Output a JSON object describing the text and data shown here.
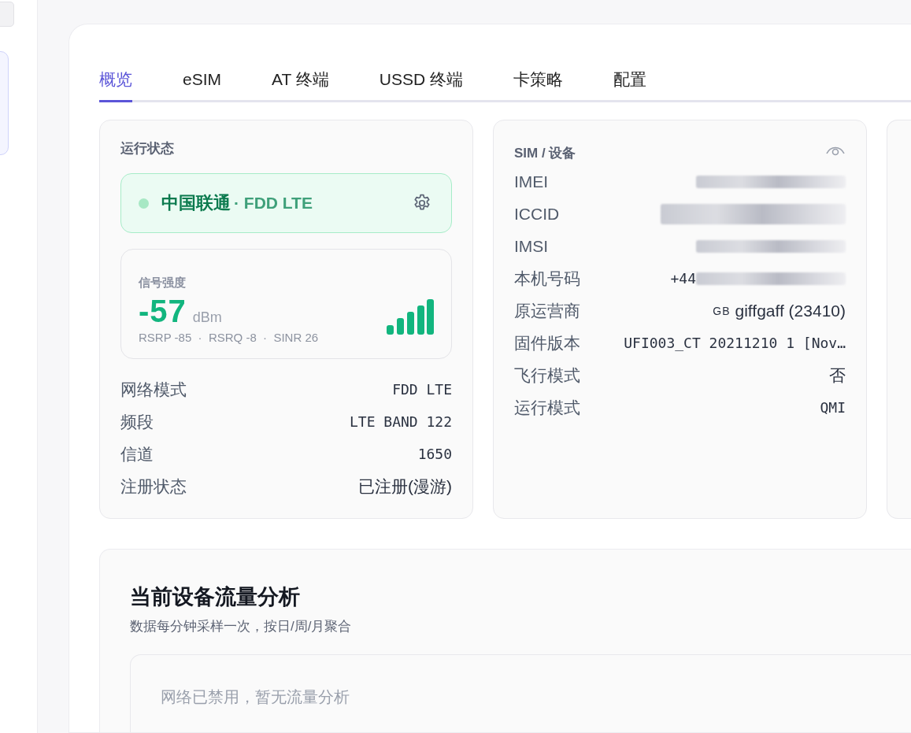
{
  "tabs": [
    {
      "label": "概览",
      "selected": true
    },
    {
      "label": "eSIM",
      "selected": false
    },
    {
      "label": "AT 终端",
      "selected": false
    },
    {
      "label": "USSD 终端",
      "selected": false
    },
    {
      "label": "卡策略",
      "selected": false
    },
    {
      "label": "配置",
      "selected": false
    }
  ],
  "status_card": {
    "title": "运行状态",
    "carrier": "中国联通",
    "network": "· FDD LTE",
    "signal": {
      "title": "信号强度",
      "value": "-57",
      "unit": "dBm",
      "details": "RSRP -85  ·  RSRQ -8  ·  SINR 26"
    },
    "rows": [
      {
        "label": "网络模式",
        "value": "FDD LTE"
      },
      {
        "label": "频段",
        "value": "LTE BAND 122"
      },
      {
        "label": "信道",
        "value": "1650"
      },
      {
        "label": "注册状态",
        "value": "已注册(漫游)",
        "kind": "plain"
      }
    ]
  },
  "sim_card": {
    "title": "SIM / 设备",
    "rows": [
      {
        "label": "IMEI",
        "kind": "redacted"
      },
      {
        "label": "ICCID",
        "kind": "redacted"
      },
      {
        "label": "IMSI",
        "kind": "redacted"
      },
      {
        "label": "本机号码",
        "kind": "redacted",
        "value": "+44"
      },
      {
        "label": "原运营商",
        "kind": "operator",
        "country": "GB",
        "value": "giffgaff (23410)"
      },
      {
        "label": "固件版本",
        "kind": "mono",
        "value": "UFI003_CT 20211210 1 [Nov…"
      },
      {
        "label": "飞行模式",
        "kind": "plain",
        "value": "否"
      },
      {
        "label": "运行模式",
        "kind": "mono",
        "value": "QMI"
      }
    ]
  },
  "traffic": {
    "title": "当前设备流量分析",
    "subtitle": "数据每分钟采样一次，按日/周/月聚合",
    "empty_message": "网络已禁用，暂无流量分析"
  }
}
